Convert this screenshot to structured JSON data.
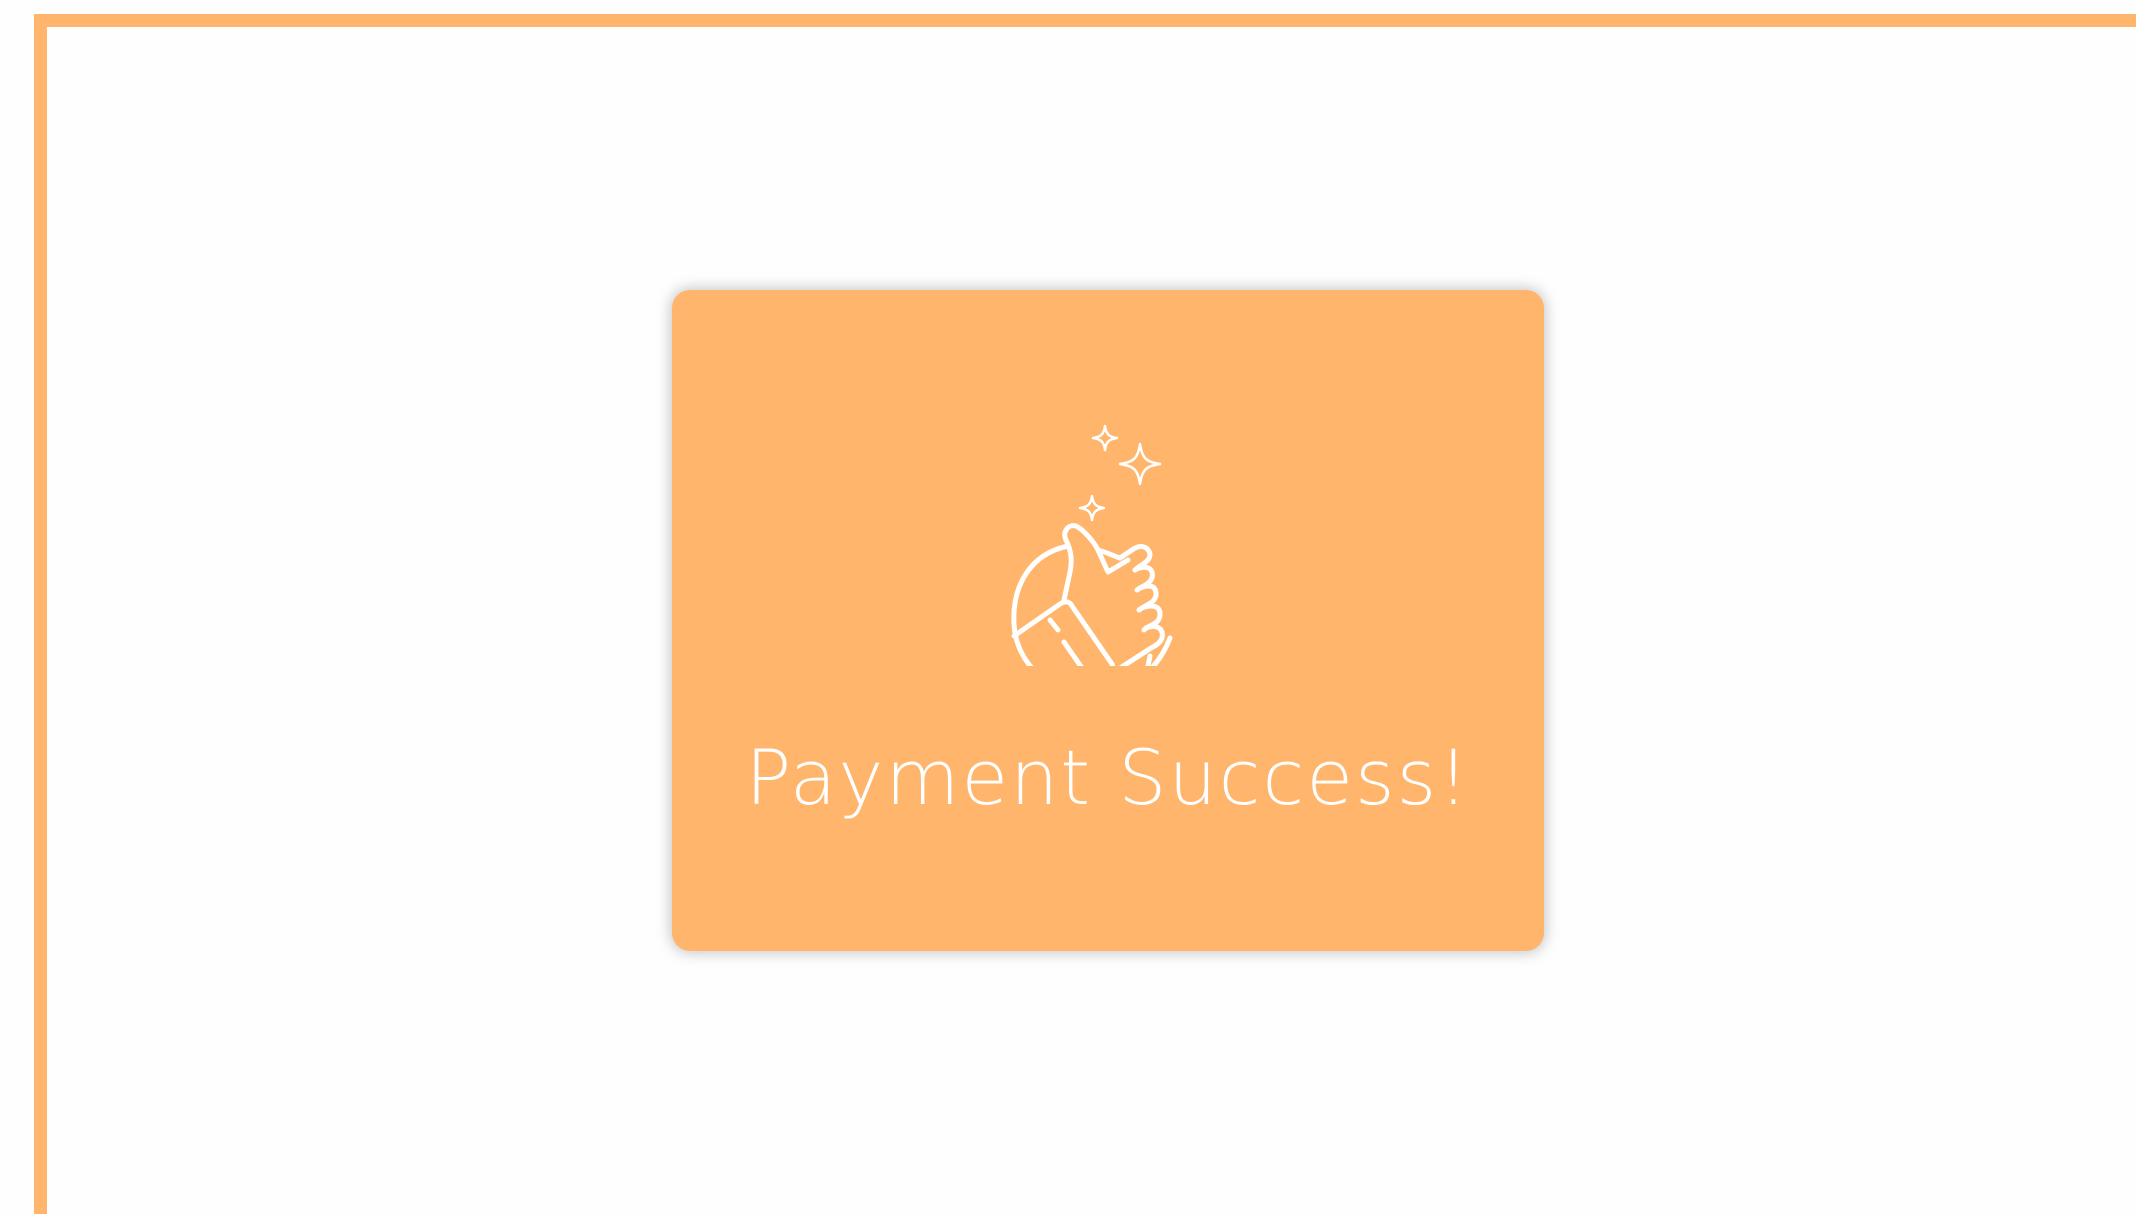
{
  "dialog": {
    "message": "Payment Success!",
    "icon": "thumbs-up-sparkle-icon"
  },
  "colors": {
    "accent": "#ffb56b",
    "background": "#fefefe",
    "text": "#ffffff"
  }
}
